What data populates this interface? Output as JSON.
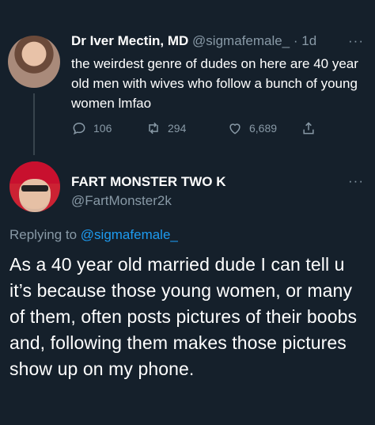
{
  "tweet1": {
    "author_name": "Dr Iver Mectin, MD",
    "handle": "@sigmafemale_",
    "separator": "·",
    "time": "1d",
    "more": "···",
    "text": "the weirdest genre of dudes on here are 40 year old men with wives who follow a bunch of young women lmfao",
    "replies": "106",
    "retweets": "294",
    "likes": "6,689"
  },
  "tweet2": {
    "author_name": "FART MONSTER TWO K",
    "handle": "@FartMonster2k",
    "more": "···",
    "replying_prefix": "Replying to ",
    "replying_to": "@sigmafemale_",
    "text": "As a 40 year old married dude I can tell u it’s because those young women, or many of them, often posts pictures of their boobs and, following them makes those pictures show up on my phone."
  },
  "colors": {
    "background": "#15202b",
    "muted": "#8899a6",
    "link": "#1d9bf0"
  },
  "icons": [
    "reply-icon",
    "retweet-icon",
    "like-icon",
    "share-icon"
  ]
}
